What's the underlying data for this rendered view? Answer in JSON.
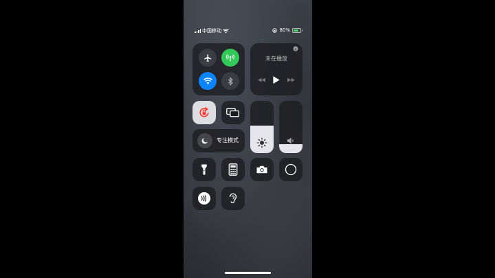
{
  "status": {
    "carrier": "中国移动",
    "battery_pct": "80%",
    "battery_level": 0.8
  },
  "media": {
    "title": "未在播放"
  },
  "focus": {
    "label": "专注模式"
  },
  "sliders": {
    "brightness_level": 0.53,
    "volume_level": 0.17
  },
  "colors": {
    "airplane_bg": "#3a3c42",
    "cellular_active": "#34c759",
    "wifi_active": "#0a84ff",
    "lock_icon": "#ff3b30",
    "battery_fill": "#4cd964"
  },
  "icons": {
    "airplane": "airplane-icon",
    "cellular": "antenna-icon",
    "wifi": "wifi-icon",
    "bluetooth": "bluetooth-icon",
    "airplay": "airplay-icon",
    "rewind": "rewind-icon",
    "play": "play-icon",
    "forward": "fast-forward-icon",
    "lock_rotation": "lock-rotation-icon",
    "mirroring": "screen-mirroring-icon",
    "moon": "moon-icon",
    "sun": "sun-icon",
    "speaker": "speaker-icon",
    "flashlight": "flashlight-icon",
    "calculator": "calculator-icon",
    "camera": "camera-icon",
    "record": "screen-record-icon",
    "nfc": "nfc-icon",
    "hearing": "ear-icon"
  }
}
